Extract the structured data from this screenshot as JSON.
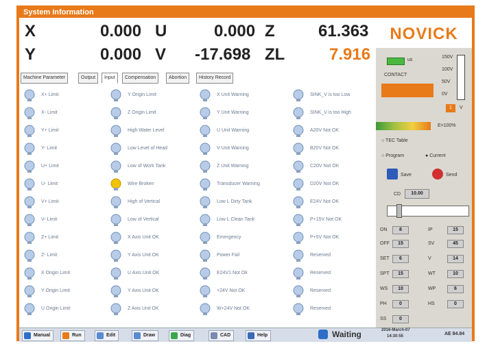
{
  "title": "System Information",
  "coords": [
    {
      "axis": "X",
      "value": "0.000"
    },
    {
      "axis": "U",
      "value": "0.000"
    },
    {
      "axis": "Z",
      "value": "61.363"
    },
    {
      "axis": "Y",
      "value": "0.000"
    },
    {
      "axis": "V",
      "value": "-17.698"
    },
    {
      "axis": "ZL",
      "value": "7.916"
    }
  ],
  "logo": "NOVICK",
  "tabs": [
    "Machine Parameter",
    "Output",
    "Input",
    "Compensation",
    "Abortion",
    "History Record"
  ],
  "columns": [
    [
      "X+ Limit",
      "X- Limit",
      "Y+ Limit",
      "Y- Limit",
      "U+ Limit",
      "U- Limit",
      "V+ Limit",
      "V- Limit",
      "Z+ Limit",
      "Z- Limit",
      "X Origin Limit",
      "Y Origin Limit",
      "U Origin Limit"
    ],
    [
      "Y Origin Limit",
      "Z Origin Limit",
      "High Water Level",
      "Low Level of Head",
      "Low of Work Tank",
      "Wire Broken",
      "High of Vertical",
      "Low of Vertical",
      "X Axis Unit OK",
      "Y Axis Unit OK",
      "U Axis Unit OK",
      "Y Axis Unit OK",
      "Z Axis Unit OK"
    ],
    [
      "X Unit Warning",
      "Y Unit Warning",
      "U Unit Warning",
      "V Unit Warning",
      "Z Unit Warning",
      "Transducer Warning",
      "Low L Dirty Tank",
      "Low L Clean Tank",
      "Emergency",
      "Power Fail",
      "E24V1 Not Ok",
      "+24V Not OK",
      "W+24V Not OK"
    ],
    [
      "SINK_V is too Low",
      "SINK_V is too High",
      "A20V Not OK",
      "B20V Not OK",
      "C20V Not OK",
      "D20V Not OK",
      "E24V Not OK",
      "P+15V Not OK",
      "P+5V Not OK",
      "Reserved",
      "Reserved",
      "Reserved",
      "Reserved"
    ]
  ],
  "yellow_bulbs": [
    "Wire Broken"
  ],
  "panel": {
    "contact": "CONTACT",
    "unit_label": "us",
    "scale": [
      "150V",
      "100V",
      "50V",
      "0V"
    ],
    "scale_value": "1",
    "scale_unit": "V",
    "percent": "E=100%",
    "tec_table": "TEC Table",
    "program": "Program",
    "current": "Current",
    "save": "Save",
    "send": "Send",
    "cd_label": "CD",
    "cd_value": "10.00",
    "params_left": [
      {
        "k": "ON",
        "v": "8"
      },
      {
        "k": "OFF",
        "v": "15"
      },
      {
        "k": "SET",
        "v": "6"
      },
      {
        "k": "SPT",
        "v": "15"
      },
      {
        "k": "WS",
        "v": "10"
      },
      {
        "k": "PH",
        "v": "0"
      },
      {
        "k": "SS",
        "v": "0"
      }
    ],
    "params_right": [
      {
        "k": "IP",
        "v": "15"
      },
      {
        "k": "SV",
        "v": "45"
      },
      {
        "k": "V",
        "v": "14"
      },
      {
        "k": "WT",
        "v": "10"
      },
      {
        "k": "WP",
        "v": "6"
      },
      {
        "k": "HS",
        "v": "0"
      }
    ]
  },
  "taskbar": {
    "buttons": [
      {
        "label": "Manual",
        "color": "#2f6ec8"
      },
      {
        "label": "Run",
        "color": "#e87a1a"
      },
      {
        "label": "Edit",
        "color": "#5a8ad0"
      },
      {
        "label": "Draw",
        "color": "#5a8ad0"
      },
      {
        "label": "Diag",
        "color": "#3aa84a"
      },
      {
        "label": "CAD",
        "color": "#7a8ab0"
      },
      {
        "label": "Help",
        "color": "#3a6ab8"
      }
    ],
    "status": "Waiting",
    "date": "2016-March-07",
    "time": "14:30:55",
    "extra": "AE 84.84"
  }
}
